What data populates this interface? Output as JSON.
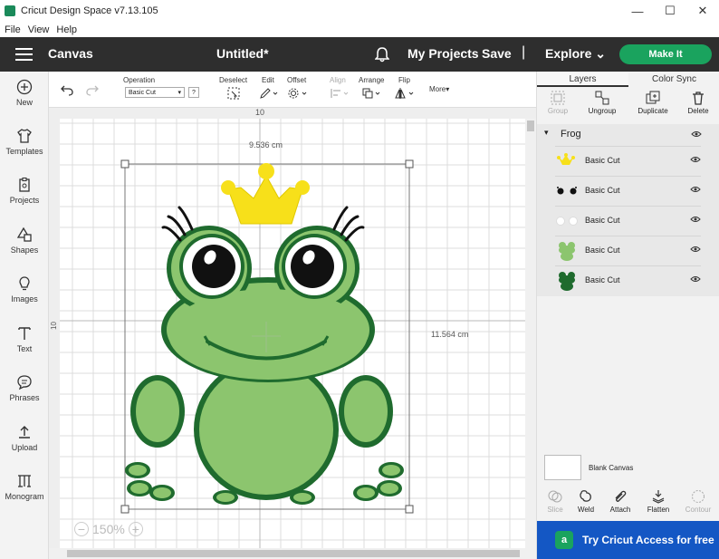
{
  "window": {
    "title": "Cricut Design Space  v7.13.105",
    "minimize": "—",
    "maximize": "☐",
    "close": "✕"
  },
  "menu": {
    "items": [
      "File",
      "View",
      "Help"
    ]
  },
  "header": {
    "canvas_label": "Canvas",
    "doc_title": "Untitled*",
    "my_projects": "My Projects",
    "save": "Save",
    "separator": "|",
    "explore": "Explore",
    "make_it": "Make It"
  },
  "leftnav": {
    "items": [
      "New",
      "Templates",
      "Projects",
      "Shapes",
      "Images",
      "Text",
      "Phrases",
      "Upload",
      "Monogram"
    ]
  },
  "toolbar": {
    "operation_label": "Operation",
    "operation_value": "Basic Cut",
    "help": "?",
    "deselect": "Deselect",
    "edit": "Edit",
    "offset": "Offset",
    "align": "Align",
    "arrange": "Arrange",
    "flip": "Flip",
    "more": "More"
  },
  "canvas": {
    "ruler_top": "10",
    "ruler_left": "10",
    "width_label": "9.536 cm",
    "height_label": "11.564 cm",
    "zoom": "150%",
    "zoom_minus": "−",
    "zoom_plus": "+"
  },
  "panel": {
    "tabs": [
      "Layers",
      "Color Sync"
    ],
    "tools": [
      "Group",
      "Ungroup",
      "Duplicate",
      "Delete"
    ],
    "group_name": "Frog",
    "layers": [
      "Basic Cut",
      "Basic Cut",
      "Basic Cut",
      "Basic Cut",
      "Basic Cut"
    ],
    "blank_canvas": "Blank Canvas",
    "bottom_tools": [
      "Slice",
      "Weld",
      "Attach",
      "Flatten",
      "Contour"
    ],
    "access_badge": "a",
    "access_text": "Try Cricut Access for free"
  },
  "colors": {
    "header_bg": "#2e2e2e",
    "make_it": "#1aa35e",
    "access": "#1457c4",
    "frog_light": "#8cc56e",
    "frog_dark": "#1f6b2e",
    "crown": "#f7e01a"
  }
}
